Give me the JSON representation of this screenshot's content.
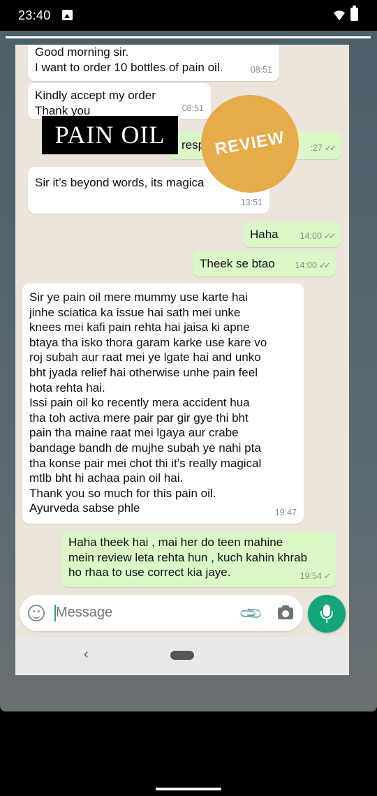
{
  "status_bar": {
    "time": "23:40"
  },
  "overlay": {
    "title": "PAIN OIL",
    "badge": "REVIEW"
  },
  "messages": [
    {
      "dir": "in",
      "text": "Good morning sir.\nI want to order 10 bottles of pain oil.",
      "time": "08:51"
    },
    {
      "dir": "in",
      "text": "Kindly accept my order\nThank you",
      "time": "08:51"
    },
    {
      "dir": "out",
      "text": "resp",
      "time": ":27"
    },
    {
      "dir": "in",
      "text": "Sir it’s beyond words, its magica",
      "time": "13:51"
    },
    {
      "dir": "out",
      "text": "Haha",
      "time": "14:00"
    },
    {
      "dir": "out",
      "text": "Theek se btao",
      "time": "14:00"
    },
    {
      "dir": "in",
      "text": "Sir ye pain oil mere mummy use karte hai\njinhe sciatica ka issue hai sath mei unke\nknees mei kafi pain rehta hai jaisa ki apne\nbtaya tha isko thora garam karke use kare vo\nroj subah aur raat mei ye lgate hai and unko\nbht jyada relief hai otherwise unhe pain feel\nhota rehta hai.\nIssi pain oil ko recently mera accident hua\ntha toh activa mere pair par gir gye thi bht\npain tha maine raat mei lgaya aur crabe\nbandage bandh de mujhe subah ye nahi pta\ntha konse pair mei chot thi it’s really magical\nmtlb bht hi achaa pain oil hai.\nThank you so much for this pain oil.\nAyurveda sabse phle",
      "time": "19:47"
    },
    {
      "dir": "out",
      "text": "Haha theek hai , mai her do teen mahine\nmein review leta rehta hun , kuch kahin khrab\nho rhaa to use correct kia jaye.",
      "time": "19:54"
    }
  ],
  "composer": {
    "placeholder": "Message"
  },
  "icons": {
    "emoji": "emoji-icon",
    "attach": "paperclip-icon",
    "camera": "camera-icon",
    "mic": "mic-icon",
    "back": "back-icon",
    "home": "home-pill"
  },
  "colors": {
    "incoming": "#ffffff",
    "outgoing": "#dcf8c6",
    "accent": "#12a67a",
    "badge": "#e6ab4a"
  }
}
